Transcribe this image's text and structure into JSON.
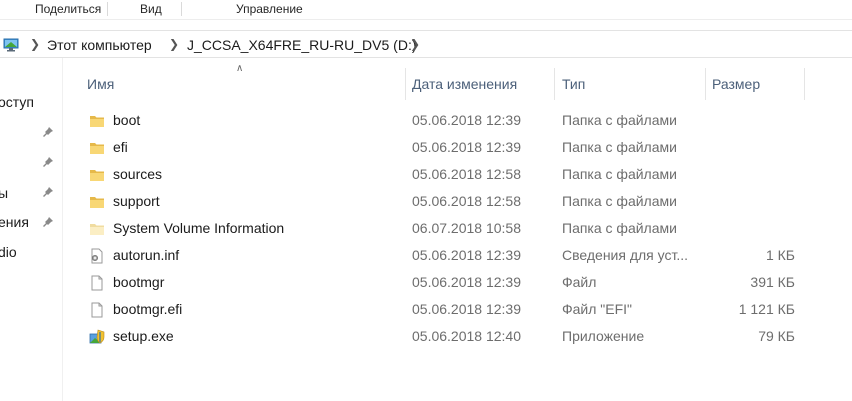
{
  "ribbon": {
    "tabs": [
      "Поделиться",
      "Вид",
      "Управление"
    ]
  },
  "address": {
    "crumbs": [
      "Этот компьютер",
      "J_CCSA_X64FRE_RU-RU_DV5 (D:)"
    ]
  },
  "nav": {
    "items": [
      "оступ",
      "",
      "",
      "ы",
      "ения",
      "dio"
    ]
  },
  "columns": {
    "name": "Имя",
    "date": "Дата изменения",
    "type": "Тип",
    "size": "Размер"
  },
  "files": [
    {
      "name": "boot",
      "date": "05.06.2018 12:39",
      "type": "Папка с файлами",
      "size": "",
      "icon": "folder-icon"
    },
    {
      "name": "efi",
      "date": "05.06.2018 12:39",
      "type": "Папка с файлами",
      "size": "",
      "icon": "folder-icon"
    },
    {
      "name": "sources",
      "date": "05.06.2018 12:58",
      "type": "Папка с файлами",
      "size": "",
      "icon": "folder-icon"
    },
    {
      "name": "support",
      "date": "05.06.2018 12:58",
      "type": "Папка с файлами",
      "size": "",
      "icon": "folder-icon"
    },
    {
      "name": "System Volume Information",
      "date": "06.07.2018 10:58",
      "type": "Папка с файлами",
      "size": "",
      "icon": "system-folder-icon"
    },
    {
      "name": "autorun.inf",
      "date": "05.06.2018 12:39",
      "type": "Сведения для уст...",
      "size": "1 КБ",
      "icon": "settings-file-icon"
    },
    {
      "name": "bootmgr",
      "date": "05.06.2018 12:39",
      "type": "Файл",
      "size": "391 КБ",
      "icon": "file-icon"
    },
    {
      "name": "bootmgr.efi",
      "date": "05.06.2018 12:39",
      "type": "Файл \"EFI\"",
      "size": "1 121 КБ",
      "icon": "file-icon"
    },
    {
      "name": "setup.exe",
      "date": "05.06.2018 12:40",
      "type": "Приложение",
      "size": "79 КБ",
      "icon": "setup-icon"
    }
  ],
  "colors": {
    "folder": "#f8d775",
    "folder_dark": "#e6b94a",
    "header_text": "#4c607a",
    "secondary_text": "#6d6d6d"
  }
}
